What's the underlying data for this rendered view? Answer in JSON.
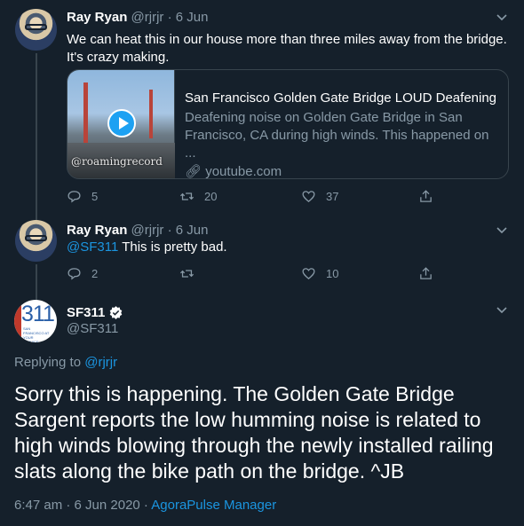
{
  "tweets": [
    {
      "name": "Ray Ryan",
      "handle": "@rjrjr",
      "date": "· 6 Jun",
      "text": "We can heat this in our house more than three miles away from the bridge. It's crazy making.",
      "card": {
        "title": "San Francisco Golden Gate Bridge LOUD Deafening ...",
        "description": "Deafening noise on Golden Gate Bridge in San Francisco, CA during high winds. This happened on ...",
        "domain": "youtube.com",
        "watermark": "@roamingrecord"
      },
      "counts": {
        "replies": "5",
        "retweets": "20",
        "likes": "37"
      }
    },
    {
      "name": "Ray Ryan",
      "handle": "@rjrjr",
      "date": "· 6 Jun",
      "mention": "@SF311",
      "text": " This is pretty bad.",
      "counts": {
        "replies": "2",
        "retweets": "",
        "likes": "10"
      }
    }
  ],
  "main": {
    "avatar_number": "311",
    "avatar_sub": "SAN FRANCISCO AT YOUR SERVICE",
    "name": "SF311",
    "handle": "@SF311",
    "replying_prefix": "Replying to ",
    "replying_to": "@rjrjr",
    "text": "Sorry this is happening. The Golden Gate Bridge Sargent reports the low humming noise is related to high winds blowing through the newly installed railing slats along the bike path on the bridge.  ^JB",
    "time": "6:47 am · 6 Jun 2020 · ",
    "source": "AgoraPulse Manager"
  },
  "colors": {
    "background": "#15202b",
    "secondary_text": "#8899a6",
    "accent": "#1b95e0",
    "border": "#38444d"
  },
  "icons": [
    "chevron-down-icon",
    "reply-icon",
    "retweet-icon",
    "like-icon",
    "share-icon",
    "link-icon",
    "play-icon",
    "verified-icon"
  ]
}
